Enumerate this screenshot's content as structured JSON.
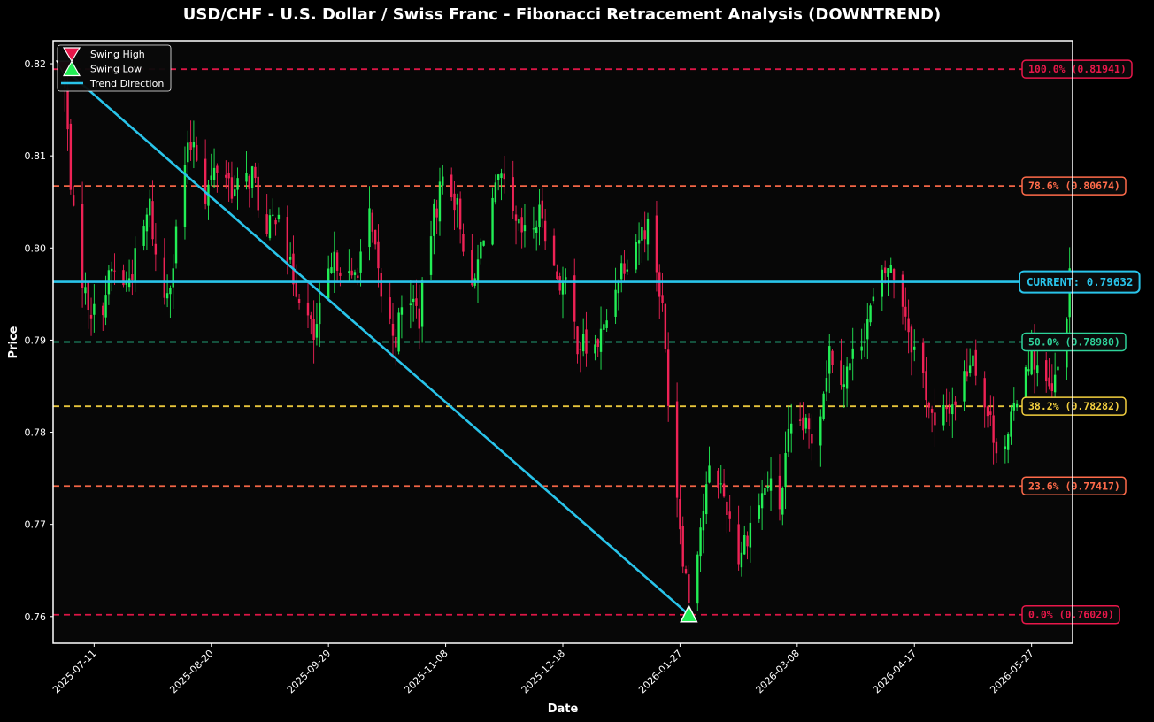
{
  "chart_data": {
    "type": "candlestick",
    "title": "USD/CHF - U.S. Dollar / Swiss Franc - Fibonacci Retracement Analysis (DOWNTREND)",
    "xlabel": "Date",
    "ylabel": "Price",
    "ylim": [
      0.7571,
      0.8225
    ],
    "x_start": "2025-06-27",
    "x_end": "2026-06-10",
    "x_ticks": [
      "2025-07-11",
      "2025-08-20",
      "2025-09-29",
      "2025-11-08",
      "2025-12-18",
      "2026-01-27",
      "2026-03-08",
      "2026-04-17",
      "2026-05-27"
    ],
    "y_ticks": [
      0.76,
      0.77,
      0.78,
      0.79,
      0.8,
      0.81,
      0.82
    ],
    "colors": {
      "background": "#070707",
      "up": "#22ee55",
      "down": "#ee2255",
      "trend": "#29c4ea",
      "current": "#29c4ea",
      "frame": "#ffffff"
    },
    "fib_levels": [
      {
        "label": "100.0% (0.81941)",
        "value": 0.81941,
        "color": "#e8174a"
      },
      {
        "label": "78.6% (0.80674)",
        "value": 0.80674,
        "color": "#ff6b4a"
      },
      {
        "label": "50.0% (0.78980)",
        "value": 0.7898,
        "color": "#2ed39a"
      },
      {
        "label": "38.2% (0.78282)",
        "value": 0.78282,
        "color": "#f4d03f"
      },
      {
        "label": "23.6% (0.77417)",
        "value": 0.77417,
        "color": "#ff6b4a"
      },
      {
        "label": "0.0% (0.76020)",
        "value": 0.7602,
        "color": "#e8174a"
      }
    ],
    "current": {
      "label": "CURRENT: 0.79632",
      "value": 0.79632
    },
    "swing_high": {
      "date": "2025-07-01",
      "value": 0.81941
    },
    "swing_low": {
      "date": "2026-01-30",
      "value": 0.7602
    },
    "trend_line": {
      "from": {
        "date": "2025-07-01",
        "value": 0.81941
      },
      "to": {
        "date": "2026-01-30",
        "value": 0.7602
      }
    },
    "legend": {
      "placement": "top-left",
      "entries": [
        {
          "label": "Swing High",
          "marker": "triangle-down",
          "color": "#e8174a"
        },
        {
          "label": "Swing Low",
          "marker": "triangle-up",
          "color": "#22ee55"
        },
        {
          "label": "Trend Direction",
          "marker": "line",
          "color": "#29c4ea"
        }
      ]
    },
    "close_anchors": [
      [
        "2025-07-01",
        0.817
      ],
      [
        "2025-07-04",
        0.803
      ],
      [
        "2025-07-08",
        0.795
      ],
      [
        "2025-07-12",
        0.792
      ],
      [
        "2025-07-17",
        0.7975
      ],
      [
        "2025-07-22",
        0.796
      ],
      [
        "2025-07-26",
        0.7995
      ],
      [
        "2025-07-30",
        0.8045
      ],
      [
        "2025-08-03",
        0.7935
      ],
      [
        "2025-08-07",
        0.7985
      ],
      [
        "2025-08-10",
        0.808
      ],
      [
        "2025-08-14",
        0.812
      ],
      [
        "2025-08-18",
        0.806
      ],
      [
        "2025-08-23",
        0.8095
      ],
      [
        "2025-08-28",
        0.806
      ],
      [
        "2025-09-03",
        0.808
      ],
      [
        "2025-09-08",
        0.801
      ],
      [
        "2025-09-12",
        0.805
      ],
      [
        "2025-09-16",
        0.7975
      ],
      [
        "2025-09-20",
        0.7945
      ],
      [
        "2025-09-24",
        0.79
      ],
      [
        "2025-09-28",
        0.7955
      ],
      [
        "2025-10-02",
        0.799
      ],
      [
        "2025-10-07",
        0.796
      ],
      [
        "2025-10-13",
        0.803
      ],
      [
        "2025-10-18",
        0.793
      ],
      [
        "2025-10-22",
        0.7905
      ],
      [
        "2025-10-26",
        0.7955
      ],
      [
        "2025-10-30",
        0.7925
      ],
      [
        "2025-11-03",
        0.802
      ],
      [
        "2025-11-08",
        0.809
      ],
      [
        "2025-11-13",
        0.803
      ],
      [
        "2025-11-17",
        0.7945
      ],
      [
        "2025-11-22",
        0.804
      ],
      [
        "2025-11-27",
        0.807
      ],
      [
        "2025-12-02",
        0.802
      ],
      [
        "2025-12-06",
        0.801
      ],
      [
        "2025-12-11",
        0.804
      ],
      [
        "2025-12-15",
        0.7975
      ],
      [
        "2025-12-19",
        0.7955
      ],
      [
        "2025-12-23",
        0.79
      ],
      [
        "2025-12-28",
        0.7885
      ],
      [
        "2026-01-01",
        0.791
      ],
      [
        "2026-01-06",
        0.7975
      ],
      [
        "2026-01-12",
        0.801
      ],
      [
        "2026-01-17",
        0.803
      ],
      [
        "2026-01-21",
        0.793
      ],
      [
        "2026-01-24",
        0.78
      ],
      [
        "2026-01-28",
        0.767
      ],
      [
        "2026-01-30",
        0.762
      ],
      [
        "2026-02-03",
        0.77
      ],
      [
        "2026-02-07",
        0.777
      ],
      [
        "2026-02-12",
        0.772
      ],
      [
        "2026-02-16",
        0.7665
      ],
      [
        "2026-02-21",
        0.771
      ],
      [
        "2026-02-26",
        0.7745
      ],
      [
        "2026-03-02",
        0.772
      ],
      [
        "2026-03-05",
        0.779
      ],
      [
        "2026-03-09",
        0.781
      ],
      [
        "2026-03-14",
        0.779
      ],
      [
        "2026-03-19",
        0.789
      ],
      [
        "2026-03-24",
        0.786
      ],
      [
        "2026-03-29",
        0.7895
      ],
      [
        "2026-04-03",
        0.794
      ],
      [
        "2026-04-08",
        0.798
      ],
      [
        "2026-04-12",
        0.796
      ],
      [
        "2026-04-16",
        0.79
      ],
      [
        "2026-04-20",
        0.786
      ],
      [
        "2026-04-24",
        0.78
      ],
      [
        "2026-04-28",
        0.7825
      ],
      [
        "2026-05-02",
        0.784
      ],
      [
        "2026-05-07",
        0.789
      ],
      [
        "2026-05-11",
        0.783
      ],
      [
        "2026-05-15",
        0.779
      ],
      [
        "2026-05-19",
        0.779
      ],
      [
        "2026-05-23",
        0.786
      ],
      [
        "2026-05-27",
        0.789
      ],
      [
        "2026-05-31",
        0.785
      ],
      [
        "2026-06-03",
        0.784
      ],
      [
        "2026-06-06",
        0.788
      ],
      [
        "2026-06-09",
        0.7963
      ]
    ]
  }
}
